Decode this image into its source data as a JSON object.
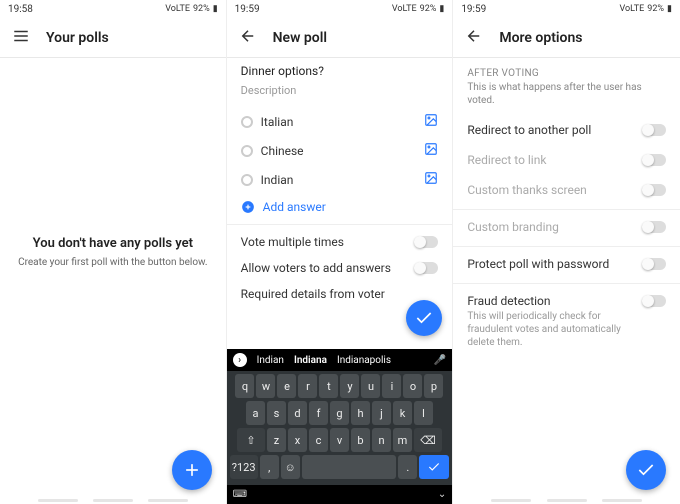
{
  "status": {
    "time1": "19:58",
    "time2": "19:59",
    "time3": "19:59",
    "carrier": "VoLTE",
    "battery": "92%"
  },
  "screen1": {
    "title": "Your polls",
    "empty_title": "You don't have any polls yet",
    "empty_sub": "Create your first poll with the button below."
  },
  "screen2": {
    "title": "New poll",
    "question": "Dinner options?",
    "desc_placeholder": "Description",
    "options": [
      "Italian",
      "Chinese",
      "Indian"
    ],
    "add_answer": "Add answer",
    "settings": {
      "multi": "Vote multiple times",
      "allow_add": "Allow voters to add answers",
      "required": "Required details from voter"
    },
    "keyboard": {
      "suggestions": [
        "Indian",
        "Indiana",
        "Indianapolis"
      ],
      "r1": [
        "q",
        "w",
        "e",
        "r",
        "t",
        "y",
        "u",
        "i",
        "o",
        "p"
      ],
      "r2": [
        "a",
        "s",
        "d",
        "f",
        "g",
        "h",
        "j",
        "k",
        "l"
      ],
      "r3_mid": [
        "z",
        "x",
        "c",
        "v",
        "b",
        "n",
        "m"
      ],
      "sym": "?123",
      "period": "."
    }
  },
  "screen3": {
    "title": "More options",
    "section": "AFTER VOTING",
    "section_desc": "This is what happens after the user has voted.",
    "opts": {
      "redirect_poll": "Redirect to another poll",
      "redirect_link": "Redirect to link",
      "thanks": "Custom thanks screen",
      "branding": "Custom branding",
      "password": "Protect poll with password",
      "fraud": "Fraud detection",
      "fraud_desc": "This will periodically check for fraudulent votes and automatically delete them."
    }
  }
}
